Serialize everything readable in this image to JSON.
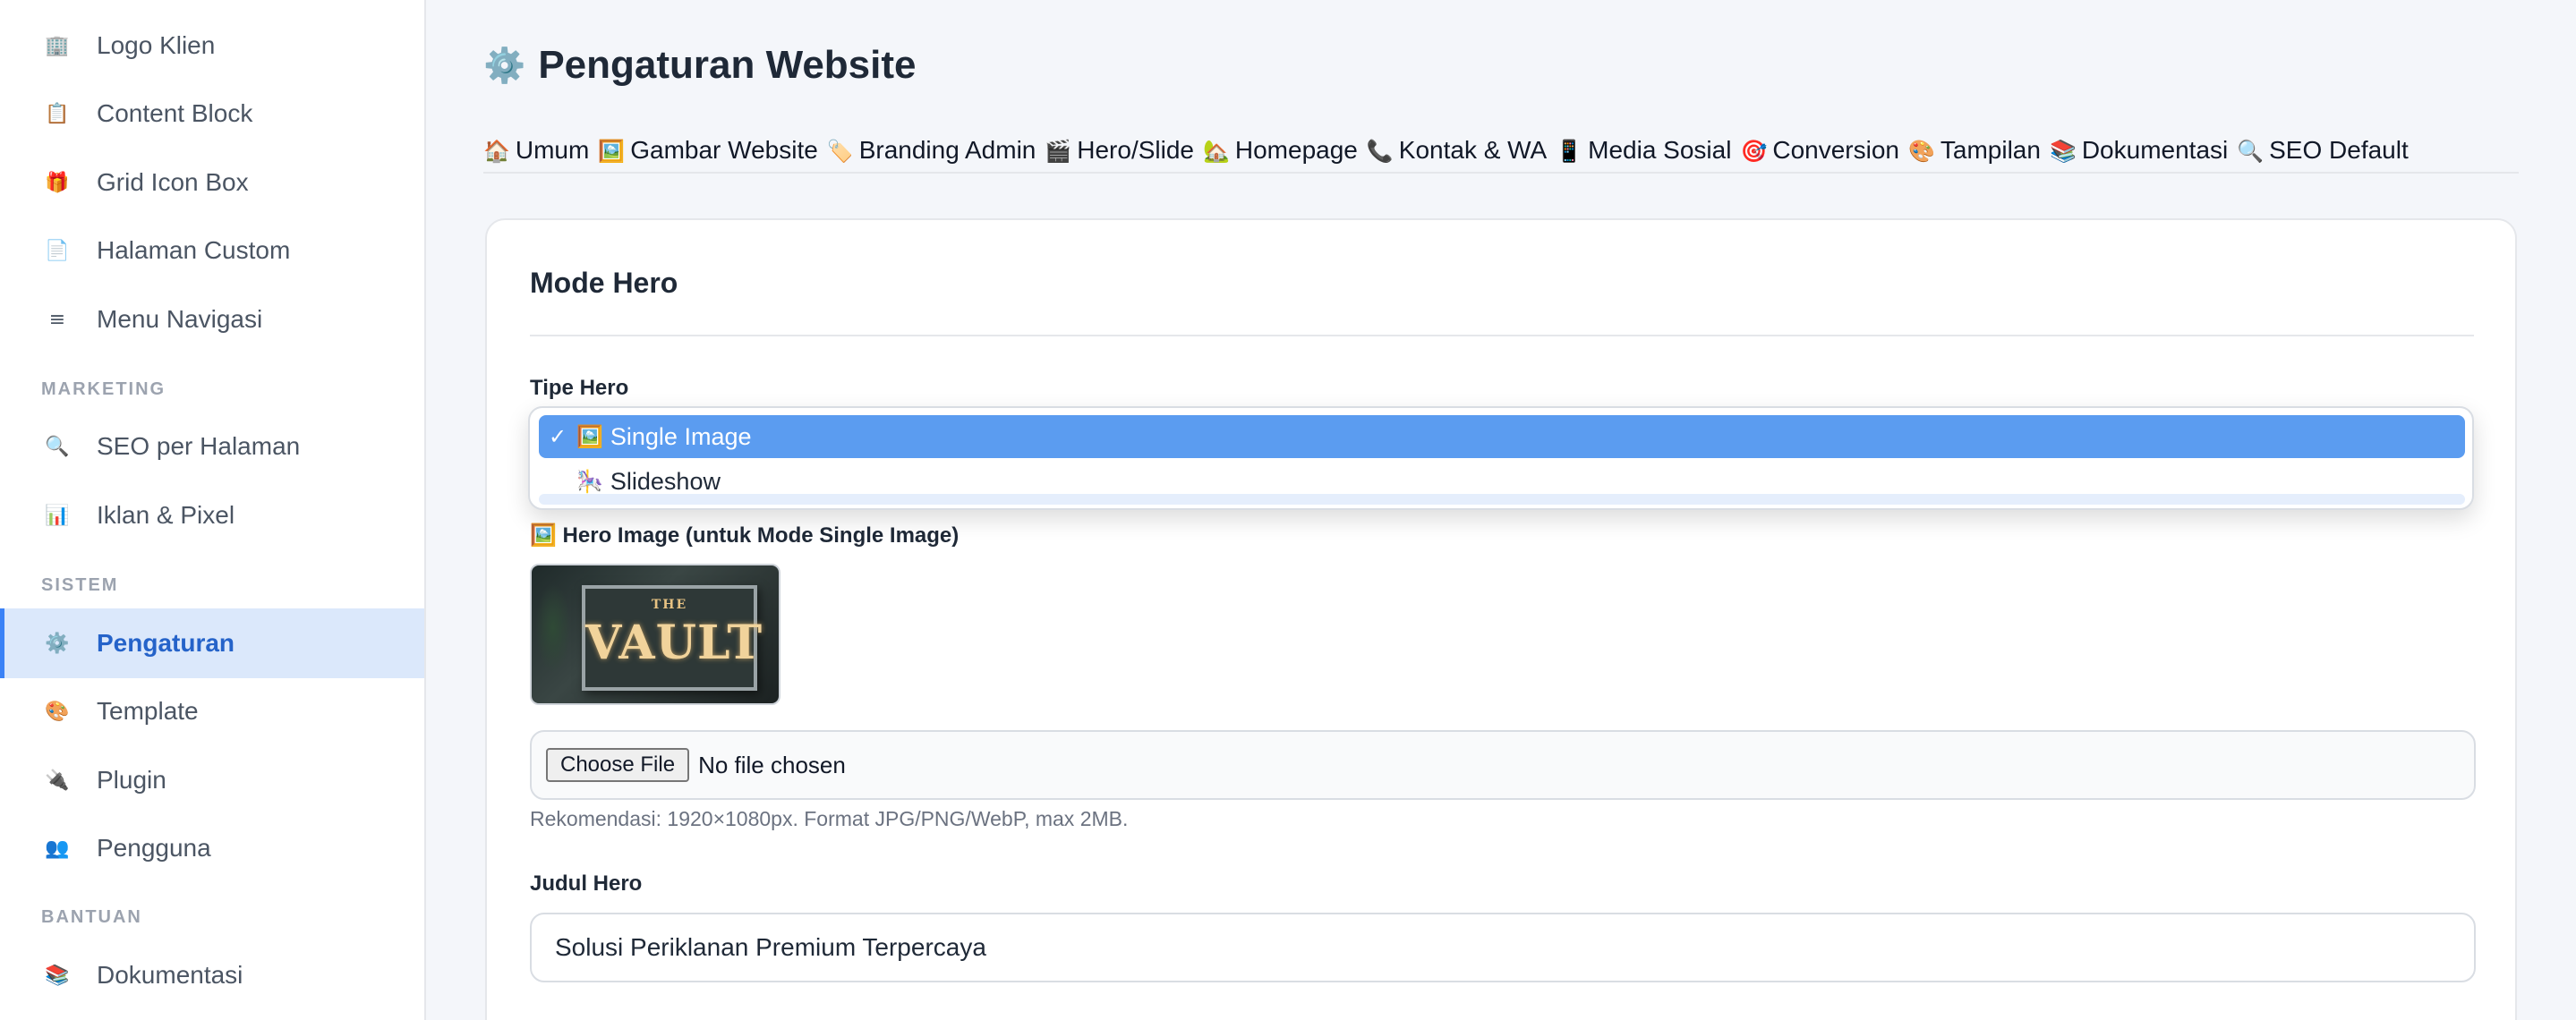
{
  "sidebar": {
    "items": [
      {
        "icon": "🏢",
        "icon_name": "building-icon",
        "label": "Logo Klien"
      },
      {
        "icon": "📋",
        "icon_name": "clipboard-icon",
        "label": "Content Block"
      },
      {
        "icon": "🎁",
        "icon_name": "gift-icon",
        "label": "Grid Icon Box"
      },
      {
        "icon": "📄",
        "icon_name": "page-icon",
        "label": "Halaman Custom"
      },
      {
        "icon": "≡",
        "icon_name": "menu-icon",
        "label": "Menu Navigasi"
      }
    ],
    "sections": {
      "marketing": "MARKETING",
      "sistem": "SISTEM",
      "bantuan": "BANTUAN"
    },
    "marketing_items": [
      {
        "icon": "🔍",
        "icon_name": "search-icon",
        "label": "SEO per Halaman"
      },
      {
        "icon": "📊",
        "icon_name": "bar-chart-icon",
        "label": "Iklan & Pixel"
      }
    ],
    "sistem_items": [
      {
        "icon": "⚙️",
        "icon_name": "gear-icon",
        "label": "Pengaturan",
        "active": true
      },
      {
        "icon": "🎨",
        "icon_name": "palette-icon",
        "label": "Template"
      },
      {
        "icon": "🔌",
        "icon_name": "plug-icon",
        "label": "Plugin"
      },
      {
        "icon": "👥",
        "icon_name": "users-icon",
        "label": "Pengguna"
      }
    ],
    "bantuan_items": [
      {
        "icon": "📚",
        "icon_name": "books-icon",
        "label": "Dokumentasi"
      }
    ]
  },
  "page": {
    "title_icon": "⚙️",
    "title": "Pengaturan Website"
  },
  "tabs": [
    {
      "icon": "🏠",
      "label": "Umum"
    },
    {
      "icon": "🖼️",
      "label": "Gambar Website"
    },
    {
      "icon": "🏷️",
      "label": "Branding Admin"
    },
    {
      "icon": "🎬",
      "label": "Hero/Slide"
    },
    {
      "icon": "🏡",
      "label": "Homepage"
    },
    {
      "icon": "📞",
      "label": "Kontak & WA"
    },
    {
      "icon": "📱",
      "label": "Media Sosial"
    },
    {
      "icon": "🎯",
      "label": "Conversion"
    },
    {
      "icon": "🎨",
      "label": "Tampilan"
    },
    {
      "icon": "📚",
      "label": "Dokumentasi"
    },
    {
      "icon": "🔍",
      "label": "SEO Default"
    }
  ],
  "card": {
    "title": "Mode Hero",
    "hero_type_label": "Tipe Hero",
    "hero_type_options": [
      {
        "check": "✓",
        "icon": "🖼️",
        "label": "Single Image",
        "selected": true
      },
      {
        "check": "",
        "icon": "🎠",
        "label": "Slideshow",
        "selected": false
      }
    ],
    "hero_image_label": "🖼️ Hero Image (untuk Mode Single Image)",
    "preview_text_small": "THE",
    "preview_text_large": "VAULT",
    "file_button": "Choose File",
    "file_status": "No file chosen",
    "file_hint": "Rekomendasi: 1920×1080px. Format JPG/PNG/WebP, max 2MB.",
    "judul_label": "Judul Hero",
    "judul_value": "Solusi Periklanan Premium Terpercaya"
  },
  "colors": {
    "accent": "#3b82f6",
    "active_bg": "#dbe8fb",
    "selected_option": "#5b9cf0",
    "page_bg": "#f4f6fa"
  }
}
